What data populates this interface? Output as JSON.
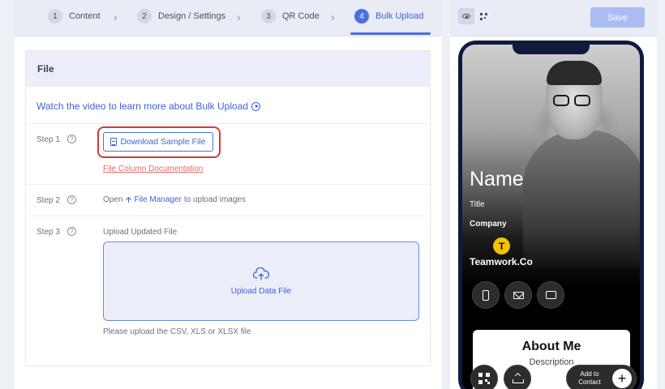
{
  "stepper": {
    "steps": [
      {
        "num": "1",
        "label": "Content"
      },
      {
        "num": "2",
        "label": "Design / Settings"
      },
      {
        "num": "3",
        "label": "QR Code"
      },
      {
        "num": "4",
        "label": "Bulk Upload"
      }
    ],
    "active_step": 4
  },
  "file_card": {
    "header": "File",
    "video_link": "Watch the video to learn more about Bulk Upload",
    "step1": {
      "label": "Step 1",
      "download_button": "Download Sample File",
      "doc_link": "File Column Documentation"
    },
    "step2": {
      "label": "Step 2",
      "prefix": "Open",
      "link": "File Manager",
      "suffix": "to upload images"
    },
    "step3": {
      "label": "Step 3",
      "upload_label": "Upload Updated File",
      "dropzone_text": "Upload Data File",
      "hint": "Please upload the CSV, XLS or XLSX file"
    }
  },
  "preview": {
    "save_label": "Save",
    "name": "Name",
    "title": "Title",
    "company": "Company",
    "logo_letter": "T",
    "brand": "Teamwork.Co",
    "about_title": "About Me",
    "about_description": "Description",
    "add_contact_label": "Add to Contact",
    "plus": "+"
  },
  "colors": {
    "accent": "#4a70e0",
    "highlight_outline": "#d43a3a",
    "doc_link": "#e46a6a",
    "save_disabled": "#a9bdf2",
    "logo_yellow": "#f2c200"
  }
}
